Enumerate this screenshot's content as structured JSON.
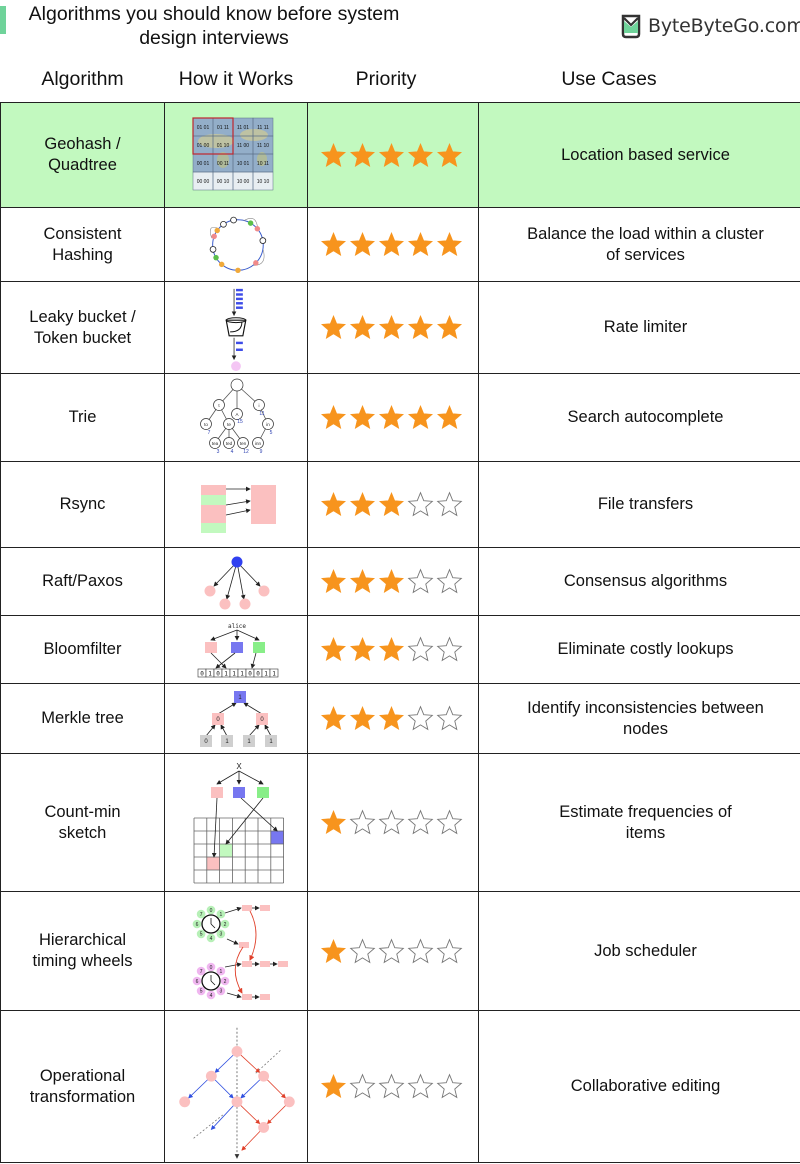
{
  "header": {
    "title_line1": "Algorithms you should know before system",
    "title_line2": "design interviews",
    "brand": "ByteByteGo.com",
    "accent_color": "#6fd39a"
  },
  "columns": [
    "Algorithm",
    "How it Works",
    "Priority",
    "Use Cases"
  ],
  "highlight_color": "#c2f9bf",
  "star_color": "#f7941d",
  "max_priority": 5,
  "rows": [
    {
      "name_lines": [
        "Geohash /",
        "Quadtree"
      ],
      "priority": 5,
      "use_lines": [
        "Location based service"
      ],
      "diagram": "geohash-grid",
      "highlighted": true,
      "geohash_cells": [
        "01 01",
        "01 11",
        "11 01",
        "11 11",
        "01 00",
        "01 10",
        "11 00",
        "11 10",
        "00 01",
        "00 11",
        "10 01",
        "10 11",
        "00 00",
        "00 10",
        "10 00",
        "10 10"
      ]
    },
    {
      "name_lines": [
        "Consistent",
        "Hashing"
      ],
      "priority": 5,
      "use_lines": [
        "Balance the load within a cluster",
        "of services"
      ],
      "diagram": "hash-ring"
    },
    {
      "name_lines": [
        "Leaky bucket /",
        "Token bucket"
      ],
      "priority": 5,
      "use_lines": [
        "Rate limiter"
      ],
      "diagram": "bucket"
    },
    {
      "name_lines": [
        "Trie"
      ],
      "priority": 5,
      "use_lines": [
        "Search autocomplete"
      ],
      "diagram": "trie",
      "trie_nodes": [
        "t",
        "A",
        "i",
        "to",
        "te",
        "in",
        "tea",
        "ted",
        "ten",
        "inn"
      ],
      "trie_values": [
        "15",
        "11",
        "7",
        "5",
        "3",
        "4",
        "12",
        "9"
      ]
    },
    {
      "name_lines": [
        "Rsync"
      ],
      "priority": 3,
      "use_lines": [
        "File transfers"
      ],
      "diagram": "rsync"
    },
    {
      "name_lines": [
        "Raft/Paxos"
      ],
      "priority": 3,
      "use_lines": [
        "Consensus algorithms"
      ],
      "diagram": "raft"
    },
    {
      "name_lines": [
        "Bloomfilter"
      ],
      "priority": 3,
      "use_lines": [
        "Eliminate costly lookups"
      ],
      "diagram": "bloom",
      "bloom_key": "alice",
      "bloom_bits": [
        "0",
        "1",
        "0",
        "1",
        "1",
        "1",
        "0",
        "0",
        "1",
        "1"
      ]
    },
    {
      "name_lines": [
        "Merkle tree"
      ],
      "priority": 3,
      "use_lines": [
        "Identify inconsistencies between",
        "nodes"
      ],
      "diagram": "merkle",
      "merkle_root": "1",
      "merkle_mid": [
        "0",
        "0"
      ],
      "merkle_leaves": [
        "0",
        "1",
        "1",
        "1"
      ]
    },
    {
      "name_lines": [
        "Count-min",
        "sketch"
      ],
      "priority": 1,
      "use_lines": [
        "Estimate frequencies of",
        "items"
      ],
      "diagram": "countmin",
      "countmin_key": "X"
    },
    {
      "name_lines": [
        "Hierarchical",
        "timing wheels"
      ],
      "priority": 1,
      "use_lines": [
        "Job scheduler"
      ],
      "diagram": "timing-wheels",
      "wheel_slots": [
        "0",
        "1",
        "2",
        "3",
        "4",
        "5",
        "6",
        "7"
      ]
    },
    {
      "name_lines": [
        "Operational",
        "transformation"
      ],
      "priority": 1,
      "use_lines": [
        "Collaborative editing"
      ],
      "diagram": "ot"
    }
  ]
}
